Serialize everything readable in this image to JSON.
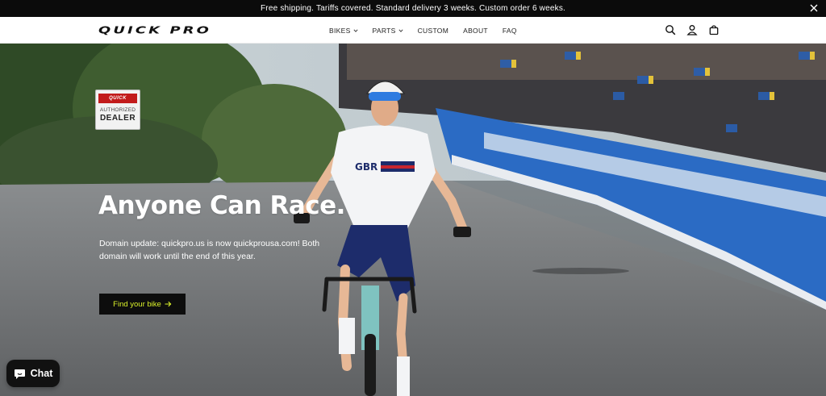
{
  "announcement": {
    "text": "Free shipping. Tariffs covered. Standard delivery 3 weeks. Custom order 6 weeks.",
    "close_icon": "close-icon"
  },
  "header": {
    "logo_text": "QUICK PRO",
    "nav": [
      {
        "label": "BIKES",
        "has_dropdown": true
      },
      {
        "label": "PARTS",
        "has_dropdown": true
      },
      {
        "label": "CUSTOM",
        "has_dropdown": false
      },
      {
        "label": "ABOUT",
        "has_dropdown": false
      },
      {
        "label": "FAQ",
        "has_dropdown": false
      }
    ],
    "icons": [
      "search-icon",
      "account-icon",
      "cart-icon"
    ]
  },
  "hero": {
    "badge": {
      "brand": "QUICK",
      "line1": "AUTHORIZED",
      "line2": "DEALER"
    },
    "headline": "Anyone Can Race.",
    "subtext": "Domain update: quickpro.us is now quickprousa.com! Both domain will work until the end of this year.",
    "cta_label": "Find your bike",
    "cta_color": "#d9f02a",
    "jersey_text": "GBR"
  },
  "chat": {
    "label": "Chat",
    "icon": "chat-bubble-icon"
  }
}
